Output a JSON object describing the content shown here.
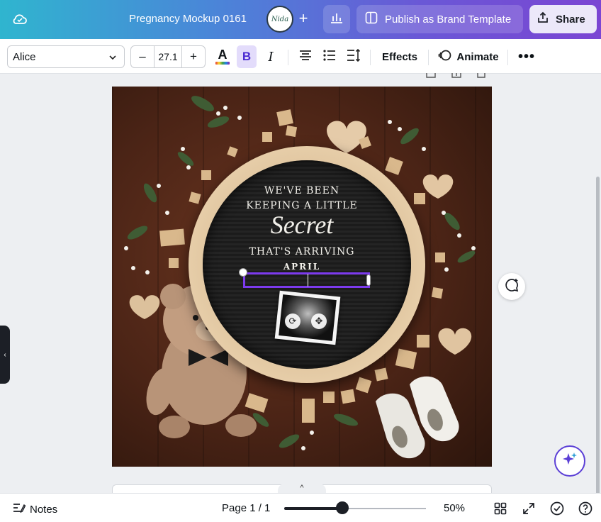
{
  "header": {
    "document_title": "Pregnancy Mockup 0161",
    "avatar_text": "Nida",
    "publish_label": "Publish as Brand Template",
    "share_label": "Share"
  },
  "toolbar": {
    "font_name": "Alice",
    "font_size": "27.1",
    "decrease_label": "–",
    "increase_label": "+",
    "color_glyph": "A",
    "bold_glyph": "B",
    "italic_glyph": "I",
    "effects_label": "Effects",
    "animate_label": "Animate",
    "more_label": "•••"
  },
  "design": {
    "line1": "WE'VE BEEN",
    "line2": "KEEPING A LITTLE",
    "line3": "Secret",
    "line4": "THAT'S ARRIVING",
    "line5": "APRIL",
    "colors": {
      "wood": "#4b2416",
      "hoop": "#e6cda8",
      "board": "#1f1f1f",
      "selection": "#7c3aed"
    }
  },
  "bottombar": {
    "notes_label": "Notes",
    "page_indicator": "Page 1 / 1",
    "zoom_label": "50%",
    "zoom_fraction": 0.41
  },
  "icons": [
    "cloud-sync-icon",
    "insights-icon",
    "publish-icon",
    "share-icon",
    "chevron-down-icon",
    "align-center-icon",
    "list-icon",
    "line-spacing-icon",
    "animate-icon",
    "comment-add-icon",
    "magic-assistant-icon",
    "notes-icon",
    "grid-view-icon",
    "fullscreen-icon",
    "check-icon",
    "help-icon"
  ]
}
